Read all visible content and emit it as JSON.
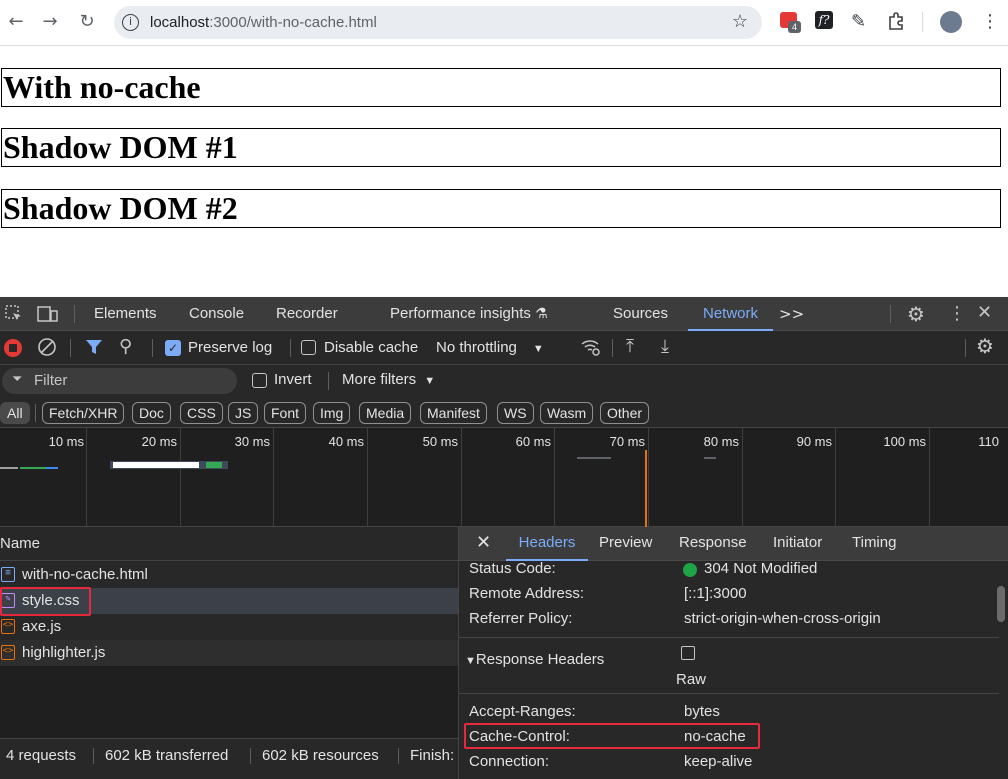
{
  "browser": {
    "url_host": "localhost",
    "url_path": ":3000/with-no-cache.html",
    "ext_badge": "4"
  },
  "page": {
    "headings": [
      "With no-cache",
      "Shadow DOM #1",
      "Shadow DOM #2"
    ]
  },
  "devtools": {
    "tabs": [
      "Elements",
      "Console",
      "Recorder",
      "Performance insights",
      "Sources",
      "Network"
    ],
    "active_tab": "Network",
    "more_tabs": ">>",
    "toolbar": {
      "preserve_log_label": "Preserve log",
      "preserve_log_checked": true,
      "disable_cache_label": "Disable cache",
      "disable_cache_checked": false,
      "throttling": "No throttling"
    },
    "filter": {
      "placeholder": "Filter",
      "invert_label": "Invert",
      "more_filters_label": "More filters"
    },
    "chips": [
      "All",
      "Fetch/XHR",
      "Doc",
      "CSS",
      "JS",
      "Font",
      "Img",
      "Media",
      "Manifest",
      "WS",
      "Wasm",
      "Other"
    ],
    "timeline_ticks": [
      "10 ms",
      "20 ms",
      "30 ms",
      "40 ms",
      "50 ms",
      "60 ms",
      "70 ms",
      "80 ms",
      "90 ms",
      "100 ms",
      "110"
    ],
    "list": {
      "header": "Name",
      "rows": [
        {
          "name": "with-no-cache.html",
          "type": "doc"
        },
        {
          "name": "style.css",
          "type": "css"
        },
        {
          "name": "axe.js",
          "type": "js"
        },
        {
          "name": "highlighter.js",
          "type": "js"
        }
      ]
    },
    "status": {
      "requests": "4 requests",
      "transferred": "602 kB transferred",
      "resources": "602 kB resources",
      "finish": "Finish:"
    },
    "detail": {
      "tabs": [
        "Headers",
        "Preview",
        "Response",
        "Initiator",
        "Timing"
      ],
      "active_tab": "Headers",
      "general": [
        {
          "key": "Status Code:",
          "value": "304 Not Modified"
        },
        {
          "key": "Remote Address:",
          "value": "[::1]:3000"
        },
        {
          "key": "Referrer Policy:",
          "value": "strict-origin-when-cross-origin"
        }
      ],
      "response_headers_label": "Response Headers",
      "raw_label": "Raw",
      "response_headers": [
        {
          "key": "Accept-Ranges:",
          "value": "bytes"
        },
        {
          "key": "Cache-Control:",
          "value": "no-cache"
        },
        {
          "key": "Connection:",
          "value": "keep-alive"
        }
      ]
    },
    "colors": {
      "accent": "#7cacf8",
      "highlight": "#e8283d",
      "status_ok": "#1ea446"
    }
  }
}
